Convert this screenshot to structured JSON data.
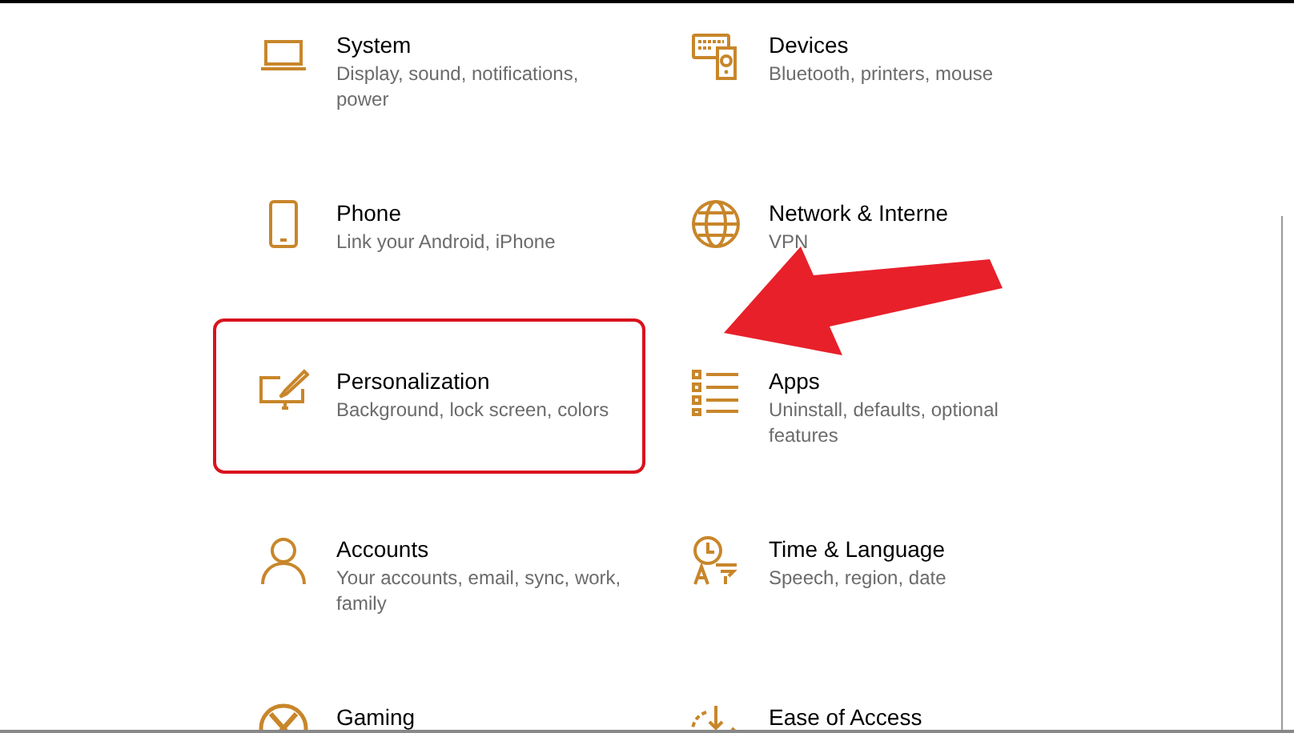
{
  "settings_items": [
    {
      "kind": "laptop",
      "title": "System",
      "subtitle": "Display, sound, notifications, power",
      "highlighted": false
    },
    {
      "kind": "devices",
      "title": "Devices",
      "subtitle": "Bluetooth, printers, mouse",
      "highlighted": false
    },
    {
      "kind": "phone",
      "title": "Phone",
      "subtitle": "Link your Android, iPhone",
      "highlighted": false
    },
    {
      "kind": "globe",
      "title": "Network & Interne",
      "subtitle": "VPN",
      "highlighted": false
    },
    {
      "kind": "personalization",
      "title": "Personalization",
      "subtitle": "Background, lock screen, colors",
      "highlighted": true
    },
    {
      "kind": "apps",
      "title": "Apps",
      "subtitle": "Uninstall, defaults, optional features",
      "highlighted": false
    },
    {
      "kind": "person",
      "title": "Accounts",
      "subtitle": "Your accounts, email, sync, work, family",
      "highlighted": false
    },
    {
      "kind": "time",
      "title": "Time & Language",
      "subtitle": "Speech, region, date",
      "highlighted": false
    },
    {
      "kind": "gaming",
      "title": "Gaming",
      "highlighted": false
    },
    {
      "kind": "ease",
      "title": "Ease of Access",
      "highlighted": false
    }
  ]
}
